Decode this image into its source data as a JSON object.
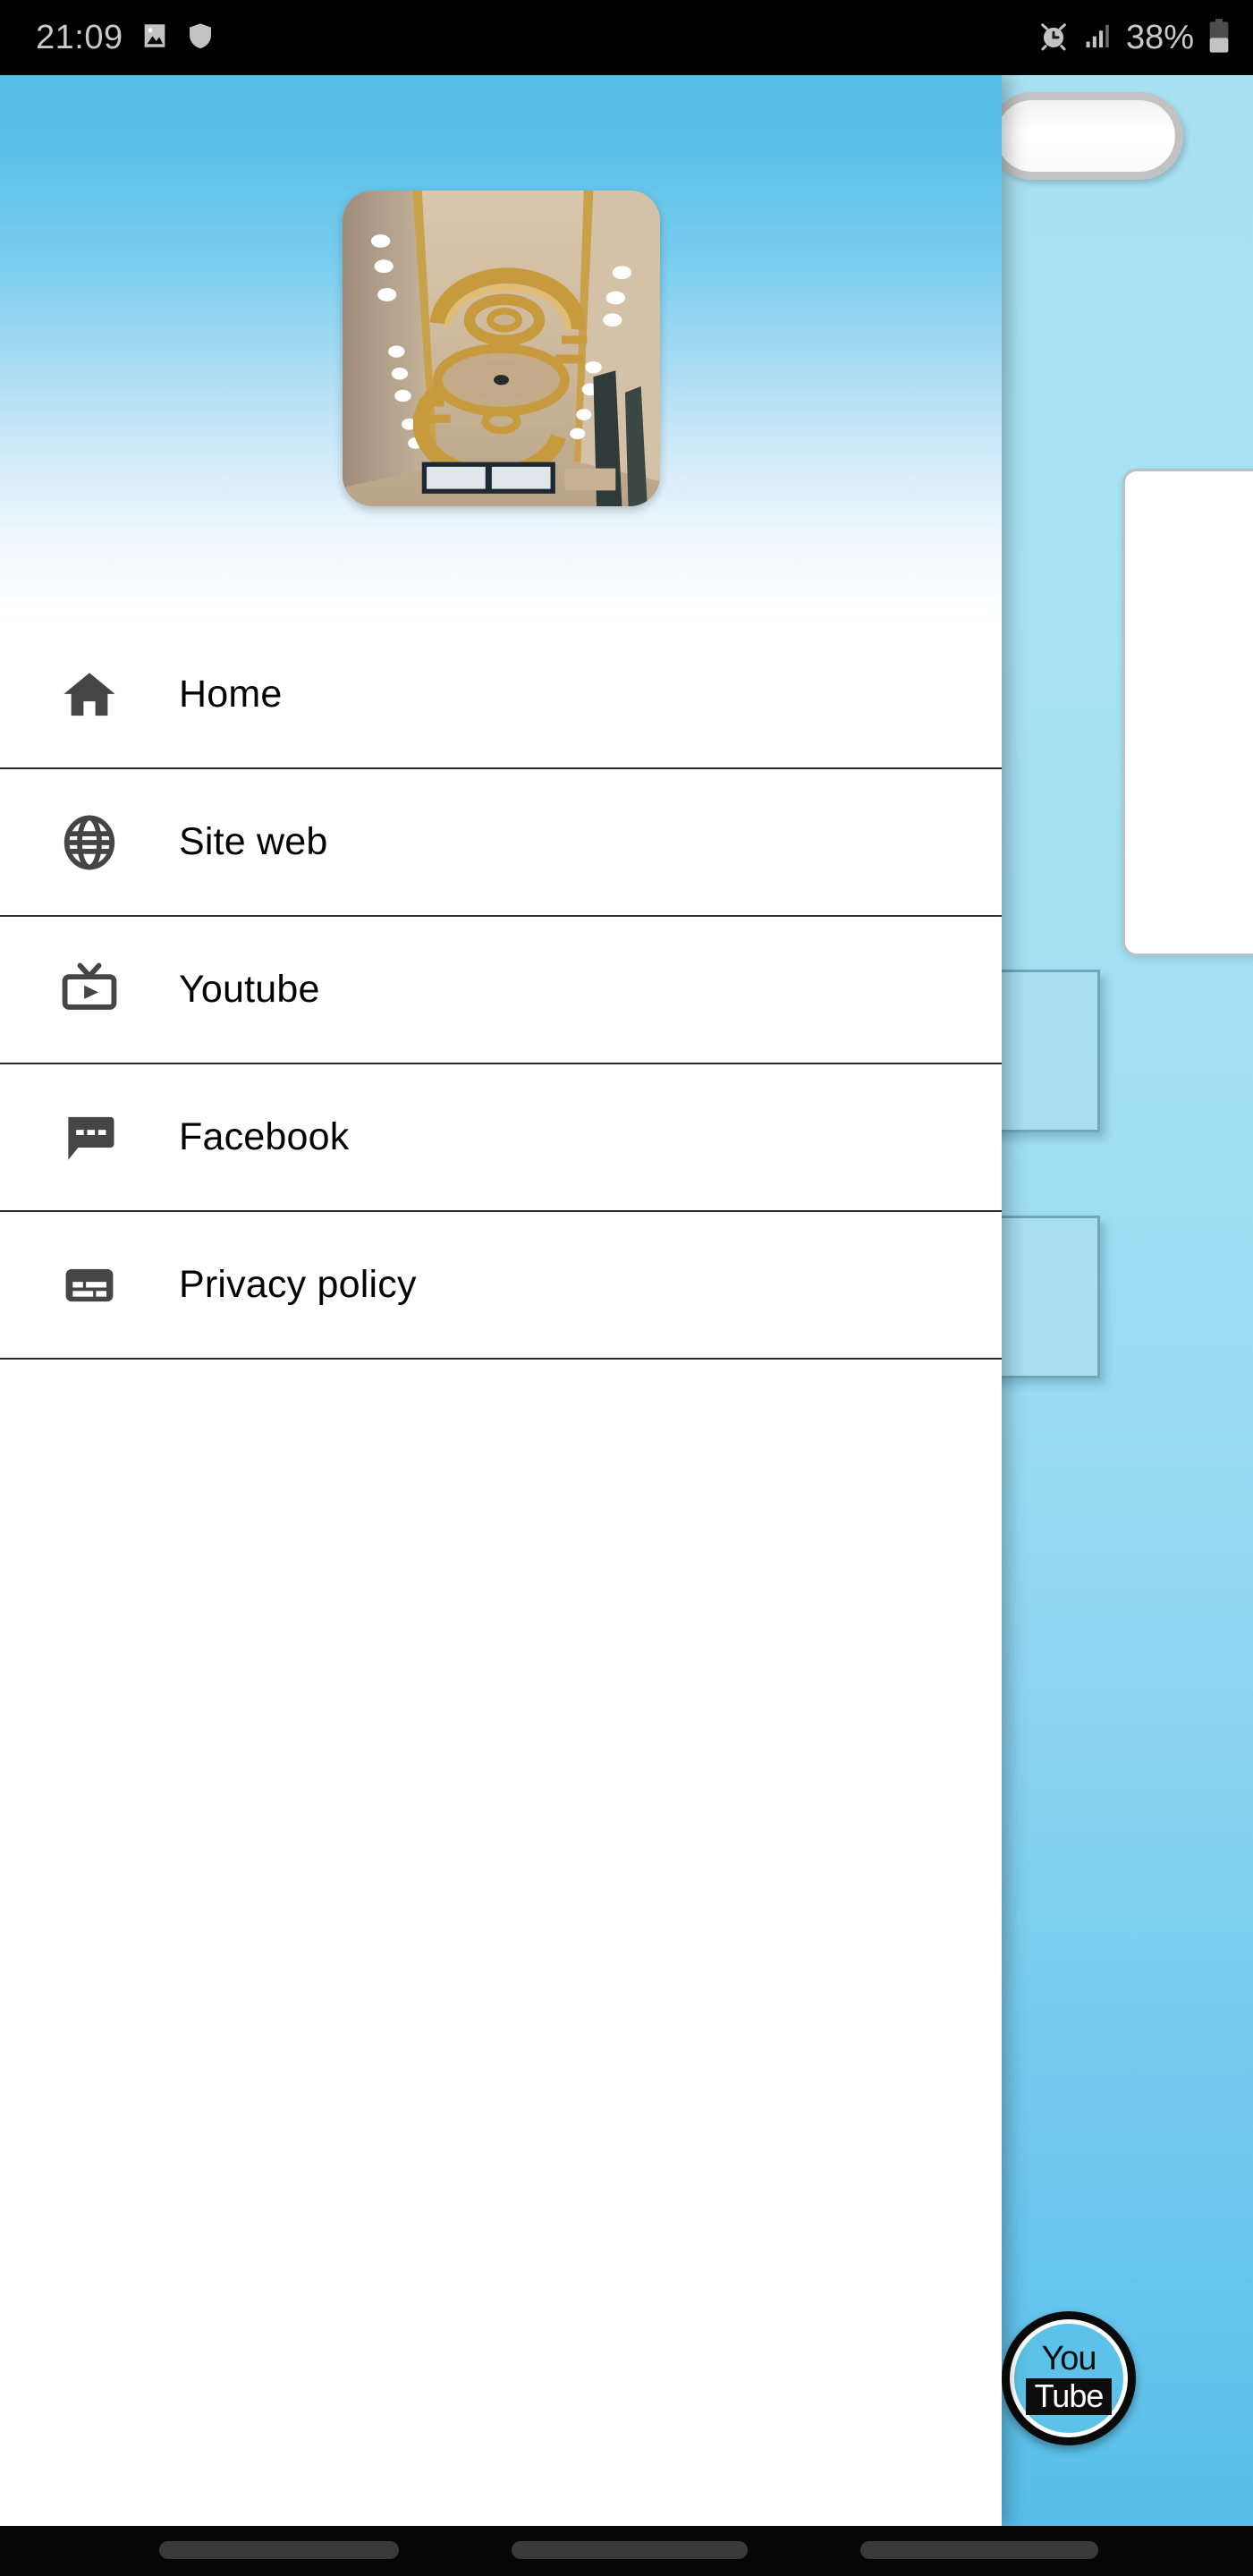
{
  "status_bar": {
    "time": "21:09",
    "left_icons": [
      "image-icon",
      "shield-icon"
    ],
    "right_icons": [
      "alarm-clock-icon",
      "signal-bars-icon",
      "battery-icon"
    ],
    "battery_percent": "38%"
  },
  "drawer": {
    "logo_alt": "false-ceiling-design-logo",
    "items": [
      {
        "label": "Home",
        "icon": "home-icon"
      },
      {
        "label": "Site web",
        "icon": "globe-icon"
      },
      {
        "label": "Youtube",
        "icon": "tv-play-icon"
      },
      {
        "label": "Facebook",
        "icon": "chat-bubble-icon"
      },
      {
        "label": "Privacy policy",
        "icon": "subtitles-icon"
      }
    ]
  },
  "background": {
    "youtube_badge": {
      "line1": "You",
      "line2": "Tube"
    }
  },
  "colors": {
    "accent_blue": "#56bfea",
    "background_blue": "#a8e1f2",
    "card_blue": "#aadff1",
    "status_bar": "#000000",
    "icon_gray": "#454545",
    "text": "#030303"
  },
  "nav_bar": {
    "pills": 3
  }
}
